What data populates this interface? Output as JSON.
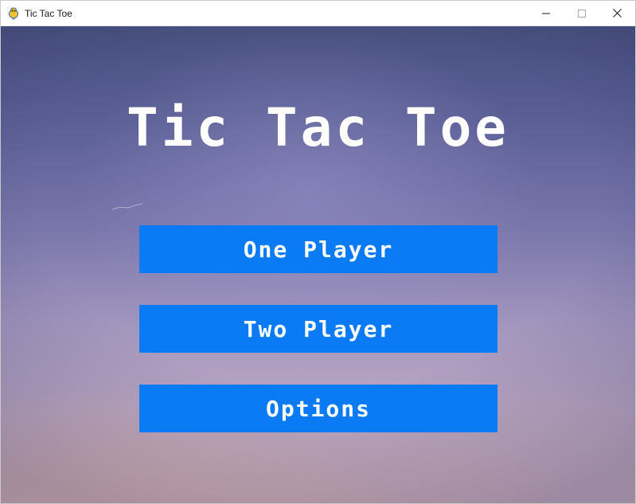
{
  "window": {
    "title": "Tic Tac Toe",
    "app_icon": "pygame-snake-icon",
    "controls": [
      "minimize-icon",
      "maximize-icon",
      "close-icon"
    ]
  },
  "game": {
    "title": "Tic Tac Toe",
    "menu": {
      "one_player": "One Player",
      "two_player": "Two Player",
      "options": "Options"
    }
  },
  "colors": {
    "button": "#0a7bf5",
    "button_text": "#ffffff",
    "title_text": "#ffffff",
    "sky_top": "#47507f",
    "sky_bottom": "#cfb0b8"
  }
}
